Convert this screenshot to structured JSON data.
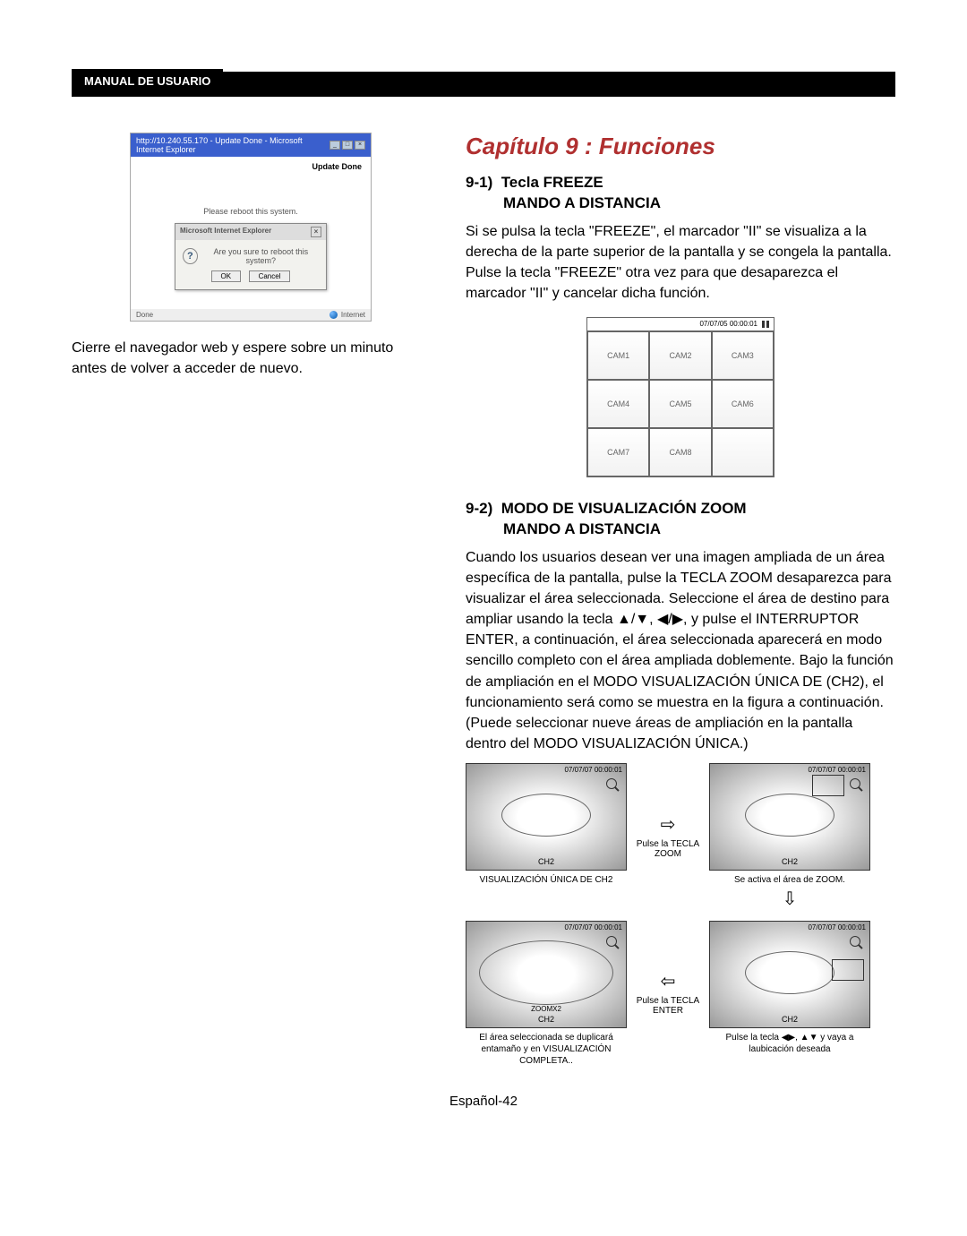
{
  "header": {
    "label": "MANUAL DE USUARIO"
  },
  "left": {
    "browser": {
      "title": "http://10.240.55.170 - Update Done - Microsoft Internet Explorer",
      "update_done": "Update Done",
      "reboot_msg": "Please reboot this system.",
      "dialog_title": "Microsoft Internet Explorer",
      "dialog_msg": "Are you sure to reboot this system?",
      "ok": "OK",
      "cancel": "Cancel",
      "status_done": "Done",
      "status_zone": "Internet"
    },
    "close_text": "Cierre el navegador web y espere sobre un minuto antes de volver a acceder de nuevo."
  },
  "right": {
    "chapter": "Capítulo 9 : Funciones",
    "sec91_num": "9-1)",
    "sec91_t1": "Tecla FREEZE",
    "sec91_t2": "MANDO A DISTANCIA",
    "sec91_body": "Si se pulsa la tecla \"FREEZE\", el marcador \"II\" se visualiza a la derecha de la parte superior de la pantalla y se congela la pantalla. Pulse la tecla \"FREEZE\" otra vez para que desaparezca el marcador \"II\" y cancelar dicha función.",
    "freeze_ts": "07/07/05  00:00:01",
    "cams": [
      "CAM1",
      "CAM2",
      "CAM3",
      "CAM4",
      "CAM5",
      "CAM6",
      "CAM7",
      "CAM8",
      ""
    ],
    "sec92_num": "9-2)",
    "sec92_t1": "MODO DE VISUALIZACIÓN ZOOM",
    "sec92_t2": "MANDO A DISTANCIA",
    "sec92_body": "Cuando los usuarios desean ver una imagen ampliada de un área específica de la pantalla, pulse la TECLA ZOOM desaparezca para visualizar el área seleccionada. Seleccione el área de destino para ampliar usando la tecla ▲/▼, ◀/▶, y pulse el INTERRUPTOR ENTER, a continuación, el área seleccionada aparecerá en modo sencillo completo con el área ampliada doblemente. Bajo la función de ampliación en el MODO VISUALIZACIÓN ÚNICA DE (CH2), el funcionamiento será como se muestra en la figura a continuación. (Puede seleccionar nueve áreas de ampliación en la pantalla dentro del MODO VISUALIZACIÓN ÚNICA.)",
    "zoom_ts": "07/07/07  00:00:01",
    "ch2": "CH2",
    "zoomx2": "ZOOMX2",
    "cap_tl": "VISUALIZACIÓN ÚNICA DE CH2",
    "cap_tr": "Se activa el área de ZOOM.",
    "cap_bl": "El área seleccionada se duplicará entamaño y en VISUALIZACIÓN COMPLETA..",
    "cap_br": "Pulse la tecla ◀▶, ▲▼ y vaya a laubicación deseada",
    "arrow_zoom": "Pulse la TECLA ZOOM",
    "arrow_enter": "Pulse la TECLA ENTER"
  },
  "footer": "Español-42"
}
